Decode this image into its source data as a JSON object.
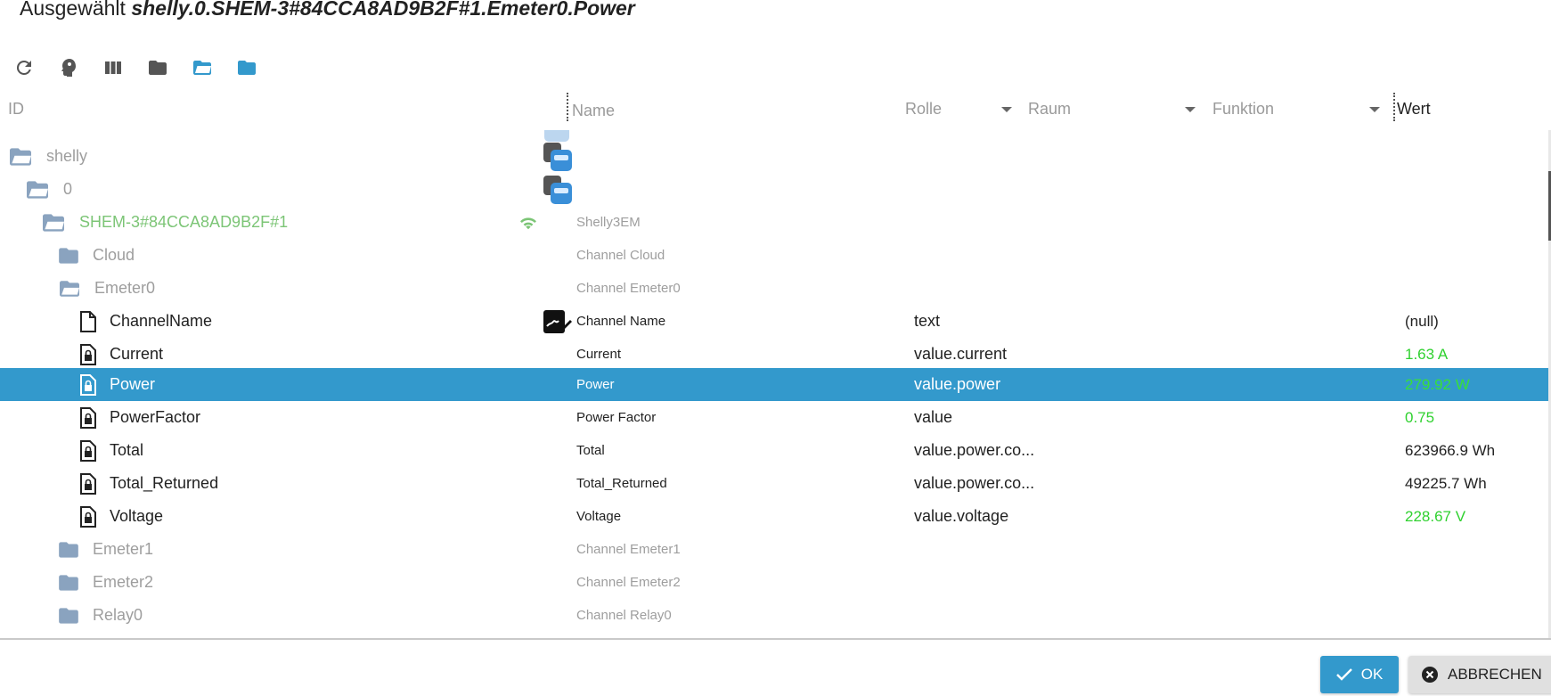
{
  "title": {
    "prefix": "Ausgewählt",
    "selected_id": "shelly.0.SHEM-3#84CCA8AD9B2F#1.Emeter0.Power"
  },
  "toolbar": {
    "icons": [
      "refresh-icon",
      "expert-mode-icon",
      "columns-icon",
      "folder-icon",
      "folder-open-icon",
      "folder-blue-icon"
    ]
  },
  "columns": {
    "id": "ID",
    "name": "Name",
    "role": "Rolle",
    "room": "Raum",
    "function": "Funktion",
    "value": "Wert"
  },
  "tree": {
    "rows": [
      {
        "id": "shelly",
        "name": "",
        "role": "",
        "value": ""
      },
      {
        "id": "0",
        "name": "",
        "role": "",
        "value": ""
      },
      {
        "id": "SHEM-3#84CCA8AD9B2F#1",
        "name": "Shelly3EM",
        "role": "",
        "value": ""
      },
      {
        "id": "Cloud",
        "name": "Channel Cloud",
        "role": "",
        "value": ""
      },
      {
        "id": "Emeter0",
        "name": "Channel Emeter0",
        "role": "",
        "value": ""
      },
      {
        "id": "ChannelName",
        "name": "Channel Name",
        "role": "text",
        "value": "(null)"
      },
      {
        "id": "Current",
        "name": "Current",
        "role": "value.current",
        "value": "1.63 A"
      },
      {
        "id": "Power",
        "name": "Power",
        "role": "value.power",
        "value": "279.92 W"
      },
      {
        "id": "PowerFactor",
        "name": "Power Factor",
        "role": "value",
        "value": "0.75"
      },
      {
        "id": "Total",
        "name": "Total",
        "role": "value.power.co...",
        "value": "623966.9 Wh"
      },
      {
        "id": "Total_Returned",
        "name": "Total_Returned",
        "role": "value.power.co...",
        "value": "49225.7 Wh"
      },
      {
        "id": "Voltage",
        "name": "Voltage",
        "role": "value.voltage",
        "value": "228.67 V"
      },
      {
        "id": "Emeter1",
        "name": "Channel Emeter1",
        "role": "",
        "value": ""
      },
      {
        "id": "Emeter2",
        "name": "Channel Emeter2",
        "role": "",
        "value": ""
      },
      {
        "id": "Relay0",
        "name": "Channel Relay0",
        "role": "",
        "value": ""
      }
    ],
    "selected_index": 7
  },
  "colors": {
    "accent": "#3399cc",
    "folder": "#8aa3bf",
    "online": "#7cc576",
    "value_green": "#2fd12f"
  },
  "buttons": {
    "ok": "OK",
    "cancel": "ABBRECHEN"
  }
}
